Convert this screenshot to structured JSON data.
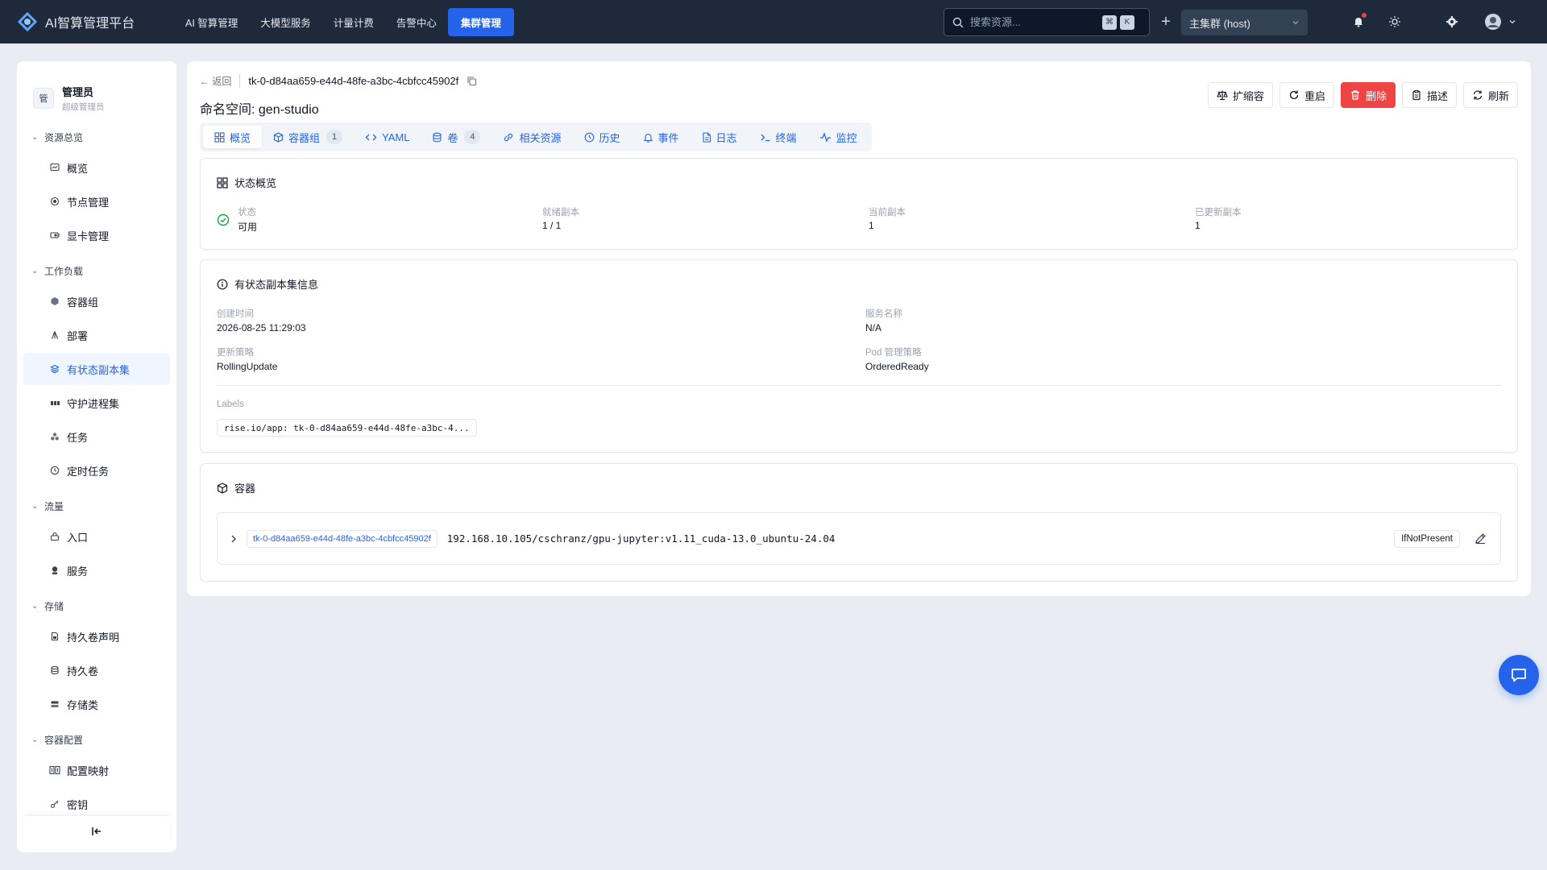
{
  "brand": {
    "name": "AI智算管理平台"
  },
  "topnav": [
    {
      "label": "AI 智算管理",
      "active": false
    },
    {
      "label": "大模型服务",
      "active": false
    },
    {
      "label": "计量计费",
      "active": false
    },
    {
      "label": "告警中心",
      "active": false
    },
    {
      "label": "集群管理",
      "active": true
    }
  ],
  "search": {
    "placeholder": "搜索资源...",
    "kbd1": "⌘",
    "kbd2": "K"
  },
  "cluster_select": {
    "value": "主集群 (host)"
  },
  "user": {
    "name": "管理员",
    "role": "超级管理员",
    "avatar_text": "管"
  },
  "sidebar": {
    "groups": [
      {
        "label": "资源总览",
        "items": [
          {
            "label": "概览",
            "icon": "dashboard-icon"
          },
          {
            "label": "节点管理",
            "icon": "node-icon"
          },
          {
            "label": "显卡管理",
            "icon": "gpu-icon"
          }
        ]
      },
      {
        "label": "工作负载",
        "items": [
          {
            "label": "容器组",
            "icon": "pod-icon"
          },
          {
            "label": "部署",
            "icon": "deploy-icon"
          },
          {
            "label": "有状态副本集",
            "icon": "statefulset-icon",
            "active": true
          },
          {
            "label": "守护进程集",
            "icon": "daemonset-icon"
          },
          {
            "label": "任务",
            "icon": "job-icon"
          },
          {
            "label": "定时任务",
            "icon": "cronjob-icon"
          }
        ]
      },
      {
        "label": "流量",
        "items": [
          {
            "label": "入口",
            "icon": "ingress-icon"
          },
          {
            "label": "服务",
            "icon": "service-icon"
          }
        ]
      },
      {
        "label": "存储",
        "items": [
          {
            "label": "持久卷声明",
            "icon": "pvc-icon"
          },
          {
            "label": "持久卷",
            "icon": "pv-icon"
          },
          {
            "label": "存储类",
            "icon": "storageclass-icon"
          }
        ]
      },
      {
        "label": "容器配置",
        "items": [
          {
            "label": "配置映射",
            "icon": "configmap-icon"
          },
          {
            "label": "密钥",
            "icon": "secret-icon"
          }
        ]
      }
    ]
  },
  "header": {
    "back_label": "← 返回",
    "resource_name": "tk-0-d84aa659-e44d-48fe-a3bc-4cbfcc45902f",
    "namespace_line": "命名空间: gen-studio"
  },
  "actions": {
    "scale": "扩缩容",
    "restart": "重启",
    "delete": "删除",
    "describe": "描述",
    "refresh": "刷新"
  },
  "tabs": [
    {
      "label": "概览",
      "icon": "grid-icon",
      "active": true
    },
    {
      "label": "容器组",
      "icon": "cube-icon",
      "badge": "1"
    },
    {
      "label": "YAML",
      "icon": "code-icon"
    },
    {
      "label": "卷",
      "icon": "database-icon",
      "badge": "4"
    },
    {
      "label": "相关资源",
      "icon": "link-icon"
    },
    {
      "label": "历史",
      "icon": "clock-icon"
    },
    {
      "label": "事件",
      "icon": "bell-icon"
    },
    {
      "label": "日志",
      "icon": "file-icon"
    },
    {
      "label": "终端",
      "icon": "terminal-icon"
    },
    {
      "label": "监控",
      "icon": "activity-icon"
    }
  ],
  "status": {
    "title": "状态概览",
    "state_label": "状态",
    "state_value": "可用",
    "ready_label": "就绪副本",
    "ready_value": "1 / 1",
    "current_label": "当前副本",
    "current_value": "1",
    "updated_label": "已更新副本",
    "updated_value": "1"
  },
  "info": {
    "title": "有状态副本集信息",
    "created_label": "创建时间",
    "created_value": "2026-08-25 11:29:03",
    "service_label": "服务名称",
    "service_value": "N/A",
    "strategy_label": "更新策略",
    "strategy_value": "RollingUpdate",
    "pod_policy_label": "Pod 管理策略",
    "pod_policy_value": "OrderedReady",
    "labels_label": "Labels",
    "label_chip": "rise.io/app: tk-0-d84aa659-e44d-48fe-a3bc-4..."
  },
  "containers": {
    "title": "容器",
    "name": "tk-0-d84aa659-e44d-48fe-a3bc-4cbfcc45902f",
    "image": "192.168.10.105/cschranz/gpu-jupyter:v1.11_cuda-13.0_ubuntu-24.04",
    "pull_policy": "IfNotPresent"
  },
  "colors": {
    "accent": "#2563eb",
    "danger": "#ef4444",
    "topbar": "#1e293b",
    "success": "#16a34a"
  }
}
